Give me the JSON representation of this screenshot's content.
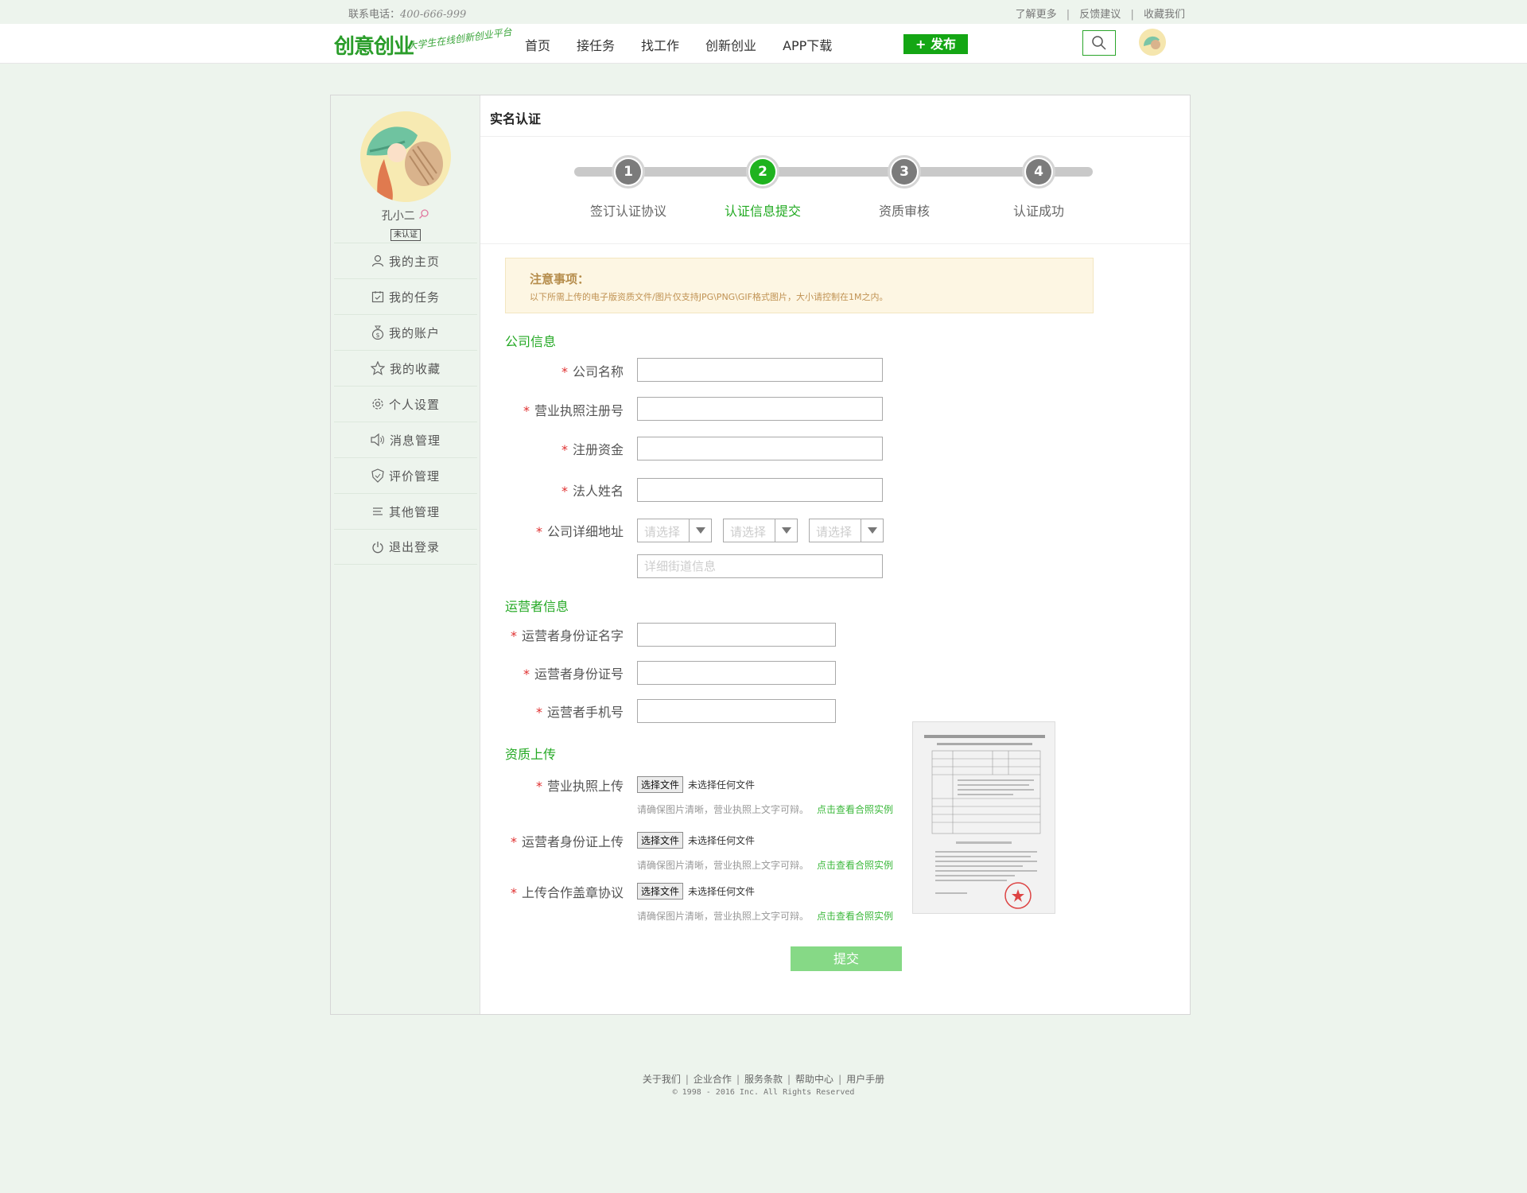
{
  "topbar": {
    "phone_label": "联系电话：",
    "phone": "400-666-999",
    "links": [
      "了解更多",
      "反馈建议",
      "收藏我们"
    ],
    "separator": "|"
  },
  "header": {
    "logo_text": "创意创业",
    "slogan": "大学生在线创新创业平台",
    "nav": [
      "首页",
      "接任务",
      "找工作",
      "创新创业",
      "APP下载"
    ],
    "publish_label": "+ 发布"
  },
  "sidebar": {
    "username": "孔小二",
    "badge": "未认证",
    "menu": [
      {
        "label": "我的主页",
        "icon": "user-icon"
      },
      {
        "label": "我的任务",
        "icon": "calendar-check-icon"
      },
      {
        "label": "我的账户",
        "icon": "money-bag-icon"
      },
      {
        "label": "我的收藏",
        "icon": "star-icon"
      },
      {
        "label": "个人设置",
        "icon": "gear-icon"
      },
      {
        "label": "消息管理",
        "icon": "speaker-icon"
      },
      {
        "label": "评价管理",
        "icon": "shield-icon"
      },
      {
        "label": "其他管理",
        "icon": "lines-icon"
      },
      {
        "label": "退出登录",
        "icon": "power-icon"
      }
    ]
  },
  "content": {
    "title": "实名认证",
    "steps": [
      {
        "num": "1",
        "label": "签订认证协议"
      },
      {
        "num": "2",
        "label": "认证信息提交"
      },
      {
        "num": "3",
        "label": "资质审核"
      },
      {
        "num": "4",
        "label": "认证成功"
      }
    ],
    "active_step": 2,
    "notice": {
      "title": "注意事项：",
      "text": "以下所需上传的电子版资质文件/图片仅支持JPG\\PNG\\GIF格式图片，大小请控制在1M之内。"
    },
    "company": {
      "section": "公司信息",
      "name_label": "公司名称",
      "license_label": "营业执照注册号",
      "capital_label": "注册资金",
      "legal_label": "法人姓名",
      "address_label": "公司详细地址",
      "select_placeholder": "请选择",
      "street_placeholder": "详细街道信息"
    },
    "operator": {
      "section": "运营者信息",
      "idname_label": "运营者身份证名字",
      "idno_label": "运营者身份证号",
      "phone_label": "运营者手机号"
    },
    "upload": {
      "section": "资质上传",
      "license_label": "营业执照上传",
      "idcard_label": "运营者身份证上传",
      "agreement_label": "上传合作盖章协议",
      "choose_btn": "选择文件",
      "no_file": "未选择任何文件",
      "hint": "请确保图片清晰，营业执照上文字可辩。",
      "example_link": "点击查看合照实例"
    },
    "required_mark": "*",
    "submit_label": "提交"
  },
  "footer": {
    "links": [
      "关于我们",
      "企业合作",
      "服务条款",
      "帮助中心",
      "用户手册"
    ],
    "copyright": "© 1998 - 2016  Inc. All Rights Reserved"
  },
  "colors": {
    "brand_green": "#14a614",
    "page_bg": "#edf4ed",
    "notice_bg": "#fdf6e3",
    "submit_bg": "#86d986"
  }
}
